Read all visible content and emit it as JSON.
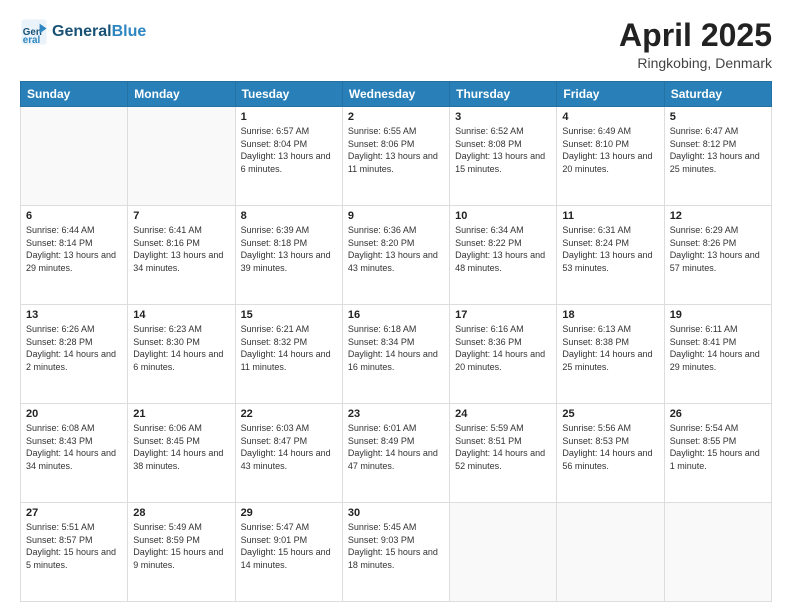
{
  "header": {
    "logo_line1": "General",
    "logo_line2": "Blue",
    "title": "April 2025",
    "subtitle": "Ringkobing, Denmark"
  },
  "weekdays": [
    "Sunday",
    "Monday",
    "Tuesday",
    "Wednesday",
    "Thursday",
    "Friday",
    "Saturday"
  ],
  "weeks": [
    [
      {
        "day": "",
        "text": ""
      },
      {
        "day": "",
        "text": ""
      },
      {
        "day": "1",
        "text": "Sunrise: 6:57 AM\nSunset: 8:04 PM\nDaylight: 13 hours and 6 minutes."
      },
      {
        "day": "2",
        "text": "Sunrise: 6:55 AM\nSunset: 8:06 PM\nDaylight: 13 hours and 11 minutes."
      },
      {
        "day": "3",
        "text": "Sunrise: 6:52 AM\nSunset: 8:08 PM\nDaylight: 13 hours and 15 minutes."
      },
      {
        "day": "4",
        "text": "Sunrise: 6:49 AM\nSunset: 8:10 PM\nDaylight: 13 hours and 20 minutes."
      },
      {
        "day": "5",
        "text": "Sunrise: 6:47 AM\nSunset: 8:12 PM\nDaylight: 13 hours and 25 minutes."
      }
    ],
    [
      {
        "day": "6",
        "text": "Sunrise: 6:44 AM\nSunset: 8:14 PM\nDaylight: 13 hours and 29 minutes."
      },
      {
        "day": "7",
        "text": "Sunrise: 6:41 AM\nSunset: 8:16 PM\nDaylight: 13 hours and 34 minutes."
      },
      {
        "day": "8",
        "text": "Sunrise: 6:39 AM\nSunset: 8:18 PM\nDaylight: 13 hours and 39 minutes."
      },
      {
        "day": "9",
        "text": "Sunrise: 6:36 AM\nSunset: 8:20 PM\nDaylight: 13 hours and 43 minutes."
      },
      {
        "day": "10",
        "text": "Sunrise: 6:34 AM\nSunset: 8:22 PM\nDaylight: 13 hours and 48 minutes."
      },
      {
        "day": "11",
        "text": "Sunrise: 6:31 AM\nSunset: 8:24 PM\nDaylight: 13 hours and 53 minutes."
      },
      {
        "day": "12",
        "text": "Sunrise: 6:29 AM\nSunset: 8:26 PM\nDaylight: 13 hours and 57 minutes."
      }
    ],
    [
      {
        "day": "13",
        "text": "Sunrise: 6:26 AM\nSunset: 8:28 PM\nDaylight: 14 hours and 2 minutes."
      },
      {
        "day": "14",
        "text": "Sunrise: 6:23 AM\nSunset: 8:30 PM\nDaylight: 14 hours and 6 minutes."
      },
      {
        "day": "15",
        "text": "Sunrise: 6:21 AM\nSunset: 8:32 PM\nDaylight: 14 hours and 11 minutes."
      },
      {
        "day": "16",
        "text": "Sunrise: 6:18 AM\nSunset: 8:34 PM\nDaylight: 14 hours and 16 minutes."
      },
      {
        "day": "17",
        "text": "Sunrise: 6:16 AM\nSunset: 8:36 PM\nDaylight: 14 hours and 20 minutes."
      },
      {
        "day": "18",
        "text": "Sunrise: 6:13 AM\nSunset: 8:38 PM\nDaylight: 14 hours and 25 minutes."
      },
      {
        "day": "19",
        "text": "Sunrise: 6:11 AM\nSunset: 8:41 PM\nDaylight: 14 hours and 29 minutes."
      }
    ],
    [
      {
        "day": "20",
        "text": "Sunrise: 6:08 AM\nSunset: 8:43 PM\nDaylight: 14 hours and 34 minutes."
      },
      {
        "day": "21",
        "text": "Sunrise: 6:06 AM\nSunset: 8:45 PM\nDaylight: 14 hours and 38 minutes."
      },
      {
        "day": "22",
        "text": "Sunrise: 6:03 AM\nSunset: 8:47 PM\nDaylight: 14 hours and 43 minutes."
      },
      {
        "day": "23",
        "text": "Sunrise: 6:01 AM\nSunset: 8:49 PM\nDaylight: 14 hours and 47 minutes."
      },
      {
        "day": "24",
        "text": "Sunrise: 5:59 AM\nSunset: 8:51 PM\nDaylight: 14 hours and 52 minutes."
      },
      {
        "day": "25",
        "text": "Sunrise: 5:56 AM\nSunset: 8:53 PM\nDaylight: 14 hours and 56 minutes."
      },
      {
        "day": "26",
        "text": "Sunrise: 5:54 AM\nSunset: 8:55 PM\nDaylight: 15 hours and 1 minute."
      }
    ],
    [
      {
        "day": "27",
        "text": "Sunrise: 5:51 AM\nSunset: 8:57 PM\nDaylight: 15 hours and 5 minutes."
      },
      {
        "day": "28",
        "text": "Sunrise: 5:49 AM\nSunset: 8:59 PM\nDaylight: 15 hours and 9 minutes."
      },
      {
        "day": "29",
        "text": "Sunrise: 5:47 AM\nSunset: 9:01 PM\nDaylight: 15 hours and 14 minutes."
      },
      {
        "day": "30",
        "text": "Sunrise: 5:45 AM\nSunset: 9:03 PM\nDaylight: 15 hours and 18 minutes."
      },
      {
        "day": "",
        "text": ""
      },
      {
        "day": "",
        "text": ""
      },
      {
        "day": "",
        "text": ""
      }
    ]
  ]
}
